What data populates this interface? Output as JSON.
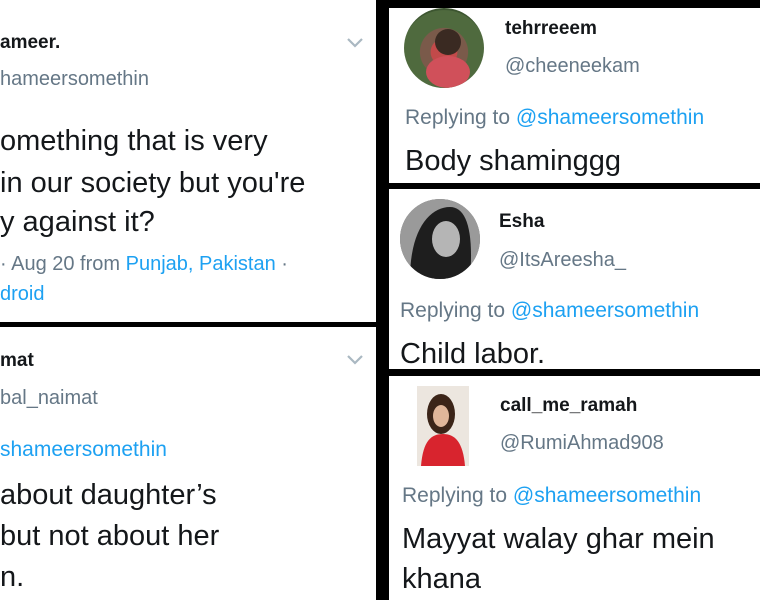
{
  "tweet_top_left": {
    "name": "ameer.",
    "handle": "hameersomethin",
    "body_lines": [
      "omething that is very",
      "in our society but you're",
      "y against it?"
    ],
    "meta_prefix": "· Aug 20 from ",
    "location": "Punjab, Pakistan",
    "meta_sep": " ·",
    "source": "droid"
  },
  "tweet_bottom_left": {
    "name": "mat",
    "handle": "bal_naimat",
    "reply_mention": "shameersomethin",
    "body_lines": [
      "about daughter’s",
      "but not about her",
      "n."
    ]
  },
  "reply_1": {
    "name": "tehrreeem",
    "handle": "@cheeneekam",
    "replying_prefix": "Replying to ",
    "replying_mention": "@shameersomethin",
    "body": "Body shaminggg"
  },
  "reply_2": {
    "name": "Esha",
    "handle": "@ItsAreesha_",
    "replying_prefix": "Replying to ",
    "replying_mention": "@shameersomethin",
    "body": "Child labor."
  },
  "reply_3": {
    "name": "call_me_ramah",
    "handle": "@RumiAhmad908",
    "replying_prefix": "Replying to ",
    "replying_mention": "@shameersomethin",
    "body_lines": [
      "Mayyat walay ghar mein",
      "khana"
    ]
  },
  "icons": {
    "chevron": "chevron-down-icon",
    "avatar": "avatar-photo"
  },
  "colors": {
    "link": "#1da1f2",
    "secondary": "#657786",
    "text": "#14171a",
    "divider": "#000000"
  }
}
